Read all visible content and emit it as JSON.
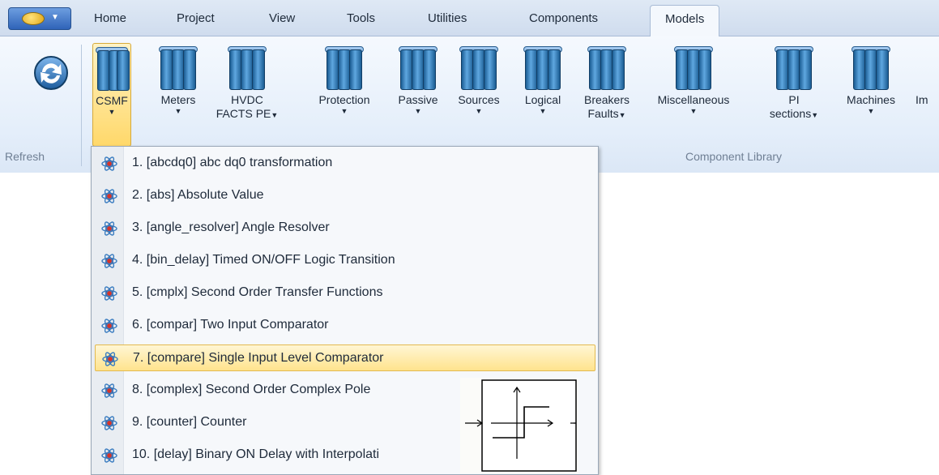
{
  "tabs": [
    "Home",
    "Project",
    "View",
    "Tools",
    "Utilities",
    "Components",
    "Models"
  ],
  "active_tab": "Models",
  "ribbon": {
    "refresh_group": "Refresh",
    "library_group": "Component Library",
    "buttons": [
      {
        "line1": "CSMF",
        "line2": ""
      },
      {
        "line1": "Meters",
        "line2": ""
      },
      {
        "line1": "HVDC",
        "line2": "FACTS PE"
      },
      {
        "line1": "Protection",
        "line2": ""
      },
      {
        "line1": "Passive",
        "line2": ""
      },
      {
        "line1": "Sources",
        "line2": ""
      },
      {
        "line1": "Logical",
        "line2": ""
      },
      {
        "line1": "Breakers",
        "line2": "Faults"
      },
      {
        "line1": "Miscellaneous",
        "line2": ""
      },
      {
        "line1": "PI",
        "line2": "sections"
      },
      {
        "line1": "Machines",
        "line2": ""
      },
      {
        "line1": "Im",
        "line2": ""
      }
    ]
  },
  "menu": {
    "items": [
      "1. [abcdq0] abc dq0 transformation",
      "2. [abs] Absolute Value",
      "3. [angle_resolver] Angle Resolver",
      "4. [bin_delay] Timed ON/OFF Logic Transition",
      "5. [cmplx] Second Order Transfer Functions",
      "6. [compar] Two Input Comparator",
      "7. [compare] Single Input Level Comparator",
      "8. [complex] Second Order Complex Pole",
      "9. [counter] Counter",
      "10. [delay] Binary ON Delay with Interpolati"
    ],
    "highlighted_index": 6
  },
  "colors": {
    "highlight": "#ffe38d",
    "icon_blue": "#3a7cc0"
  }
}
